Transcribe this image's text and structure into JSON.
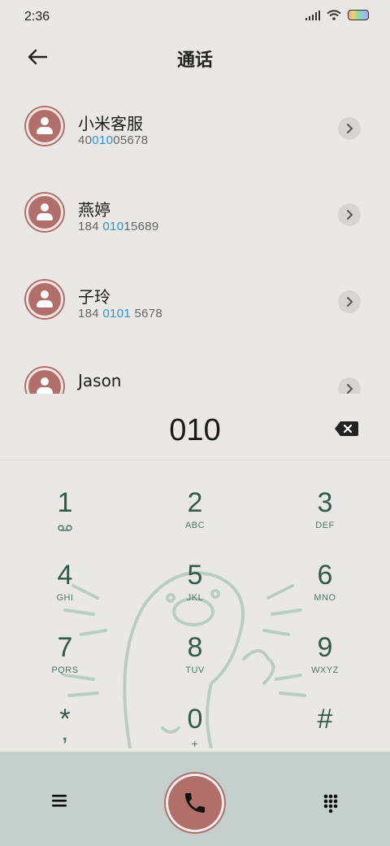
{
  "status": {
    "time": "2:36",
    "icons": [
      "signal-icon",
      "wifi-icon",
      "battery-icon"
    ]
  },
  "header": {
    "title": "通话",
    "back_icon": "arrow-left-icon"
  },
  "contacts": [
    {
      "name": "小米客服",
      "num_pre": "40",
      "num_hl": "010",
      "num_post": "05678"
    },
    {
      "name": "燕婷",
      "num_pre": "184 ",
      "num_hl": "010",
      "num_post": "15689"
    },
    {
      "name": "子玲",
      "num_pre": "184 ",
      "num_hl": "0101",
      "num_post": " 5678"
    },
    {
      "name": "Jason",
      "num_pre": "",
      "num_hl": "",
      "num_post": ""
    }
  ],
  "dial": {
    "number": "010"
  },
  "keys": [
    {
      "digit": "1",
      "letters": ""
    },
    {
      "digit": "2",
      "letters": "ABC"
    },
    {
      "digit": "3",
      "letters": "DEF"
    },
    {
      "digit": "4",
      "letters": "GHI"
    },
    {
      "digit": "5",
      "letters": "JKL"
    },
    {
      "digit": "6",
      "letters": "MNO"
    },
    {
      "digit": "7",
      "letters": "PQRS"
    },
    {
      "digit": "8",
      "letters": "TUV"
    },
    {
      "digit": "9",
      "letters": "WXYZ"
    },
    {
      "digit": "*",
      "letters": ","
    },
    {
      "digit": "0",
      "letters": "+"
    },
    {
      "digit": "#",
      "letters": ""
    }
  ],
  "colors": {
    "accent": "#b26f6a",
    "key_text": "#33594c",
    "highlight": "#2a96d8",
    "bottom_bar": "#c5cfcb"
  }
}
